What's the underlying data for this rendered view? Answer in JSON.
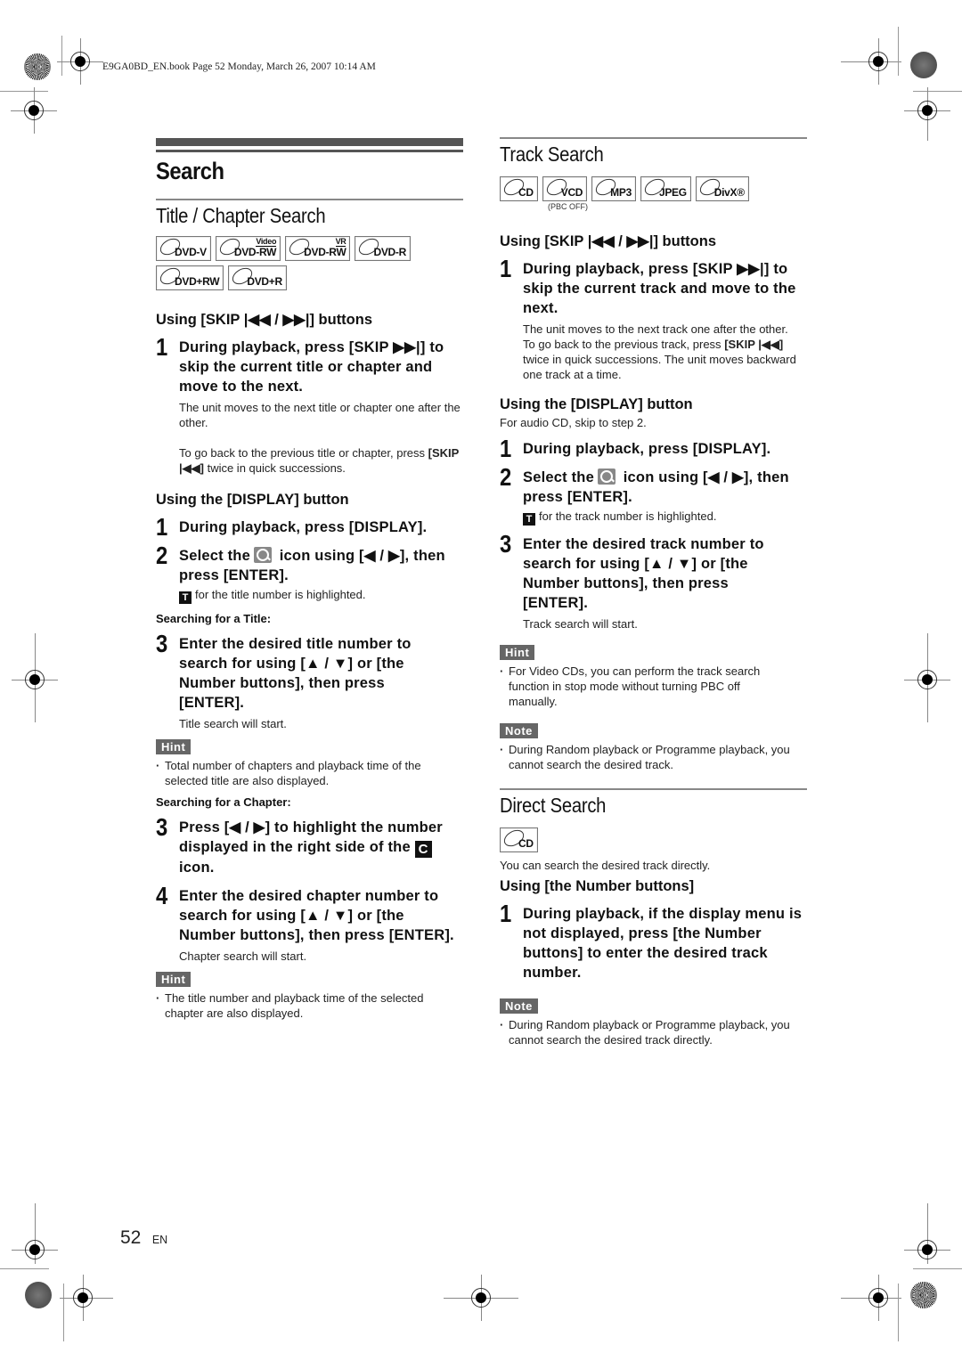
{
  "print_header": "E9GA0BD_EN.book  Page 52  Monday, March 26, 2007  10:14 AM",
  "left": {
    "section_title": "Search",
    "subsection_title": "Title / Chapter Search",
    "badges": [
      {
        "label": "DVD-V",
        "sup": ""
      },
      {
        "label": "DVD-RW",
        "sup": "Video"
      },
      {
        "label": "DVD-RW",
        "sup": "VR"
      },
      {
        "label": "DVD-R",
        "sup": ""
      },
      {
        "label": "DVD+RW",
        "sup": ""
      },
      {
        "label": "DVD+R",
        "sup": ""
      }
    ],
    "skip_heading": "Using [SKIP |◀◀ / ▶▶|] buttons",
    "skip_step1_num": "1",
    "skip_step1_text": "During playback, press [SKIP ▶▶|] to skip the current title or chapter and move to the next.",
    "skip_step1_body1": "The unit moves to the next title or chapter one after the other.",
    "skip_step1_body2_pre": "To go back to the previous title or chapter, press",
    "skip_step1_body2_bold": "[SKIP |◀◀]",
    "skip_step1_body2_post": " twice in quick successions.",
    "display_heading": "Using the [DISPLAY] button",
    "display_step1_num": "1",
    "display_step1_text": "During playback, press [DISPLAY].",
    "display_step2_num": "2",
    "display_step2_pre": "Select the",
    "display_step2_post": "icon using [◀ / ▶], then press [ENTER].",
    "display_step2_body_icon": "T",
    "display_step2_body": "for the title number is highlighted.",
    "searching_title_label": "Searching for a Title:",
    "title_step3_num": "3",
    "title_step3_text": "Enter the desired title number to search for using [▲ / ▼] or [the Number buttons], then press [ENTER].",
    "title_step3_body": "Title search will start.",
    "hint1_tag": "Hint",
    "hint1_text": "Total number of chapters and playback time of the selected title are also displayed.",
    "searching_chapter_label": "Searching for a Chapter:",
    "chapter_step3_num": "3",
    "chapter_step3_pre": "Press [◀ / ▶] to highlight the number displayed in the right side of the",
    "chapter_step3_icon": "C",
    "chapter_step3_post": "icon.",
    "chapter_step4_num": "4",
    "chapter_step4_text": "Enter the desired chapter number to search for using [▲ / ▼] or [the Number buttons], then press [ENTER].",
    "chapter_step4_body": "Chapter search will start.",
    "hint2_tag": "Hint",
    "hint2_text": "The title number and playback time of the selected chapter are also displayed."
  },
  "right": {
    "track_title": "Track Search",
    "track_badges": [
      {
        "label": "CD",
        "sup": ""
      },
      {
        "label": "VCD",
        "sup": ""
      },
      {
        "label": "MP3",
        "sup": ""
      },
      {
        "label": "JPEG",
        "sup": ""
      },
      {
        "label": "DivX®",
        "sup": ""
      }
    ],
    "vcd_note": "(PBC OFF)",
    "skip_heading": "Using [SKIP |◀◀ / ▶▶|] buttons",
    "skip_step1_num": "1",
    "skip_step1_text": "During playback, press [SKIP ▶▶|] to skip the current track and move to the next.",
    "skip_step1_body1": "The unit moves to the next track one after the other.",
    "skip_step1_body2_pre": "To go back to the previous track, press",
    "skip_step1_body2_bold": "[SKIP |◀◀]",
    "skip_step1_body2_post": " twice in quick successions. The unit moves backward one track at a time.",
    "display_heading": "Using the [DISPLAY] button",
    "display_note": "For audio CD, skip to step 2.",
    "display_step1_num": "1",
    "display_step1_text": "During playback, press [DISPLAY].",
    "display_step2_num": "2",
    "display_step2_pre": "Select the",
    "display_step2_post": "icon using [◀ / ▶], then press [ENTER].",
    "display_step2_body_icon": "T",
    "display_step2_body": "for the track number is highlighted.",
    "display_step3_num": "3",
    "display_step3_text": "Enter the desired track number to search for using [▲ / ▼] or [the Number buttons], then press [ENTER].",
    "display_step3_body": "Track search will start.",
    "hint_tag": "Hint",
    "hint_text": "For Video CDs, you can perform the track search function in stop mode without turning PBC off manually.",
    "note1_tag": "Note",
    "note1_text": "During Random playback or Programme playback, you cannot search the desired track.",
    "direct_title": "Direct Search",
    "direct_badges": [
      {
        "label": "CD",
        "sup": ""
      }
    ],
    "direct_intro": "You can search the desired track directly.",
    "direct_heading": "Using [the Number buttons]",
    "direct_step1_num": "1",
    "direct_step1_text": "During playback, if the display menu is not displayed, press [the Number buttons] to enter the desired track number.",
    "note2_tag": "Note",
    "note2_text": "During Random playback or Programme playback, you cannot search the desired track directly."
  },
  "footer": {
    "page_number": "52",
    "language": "EN"
  }
}
